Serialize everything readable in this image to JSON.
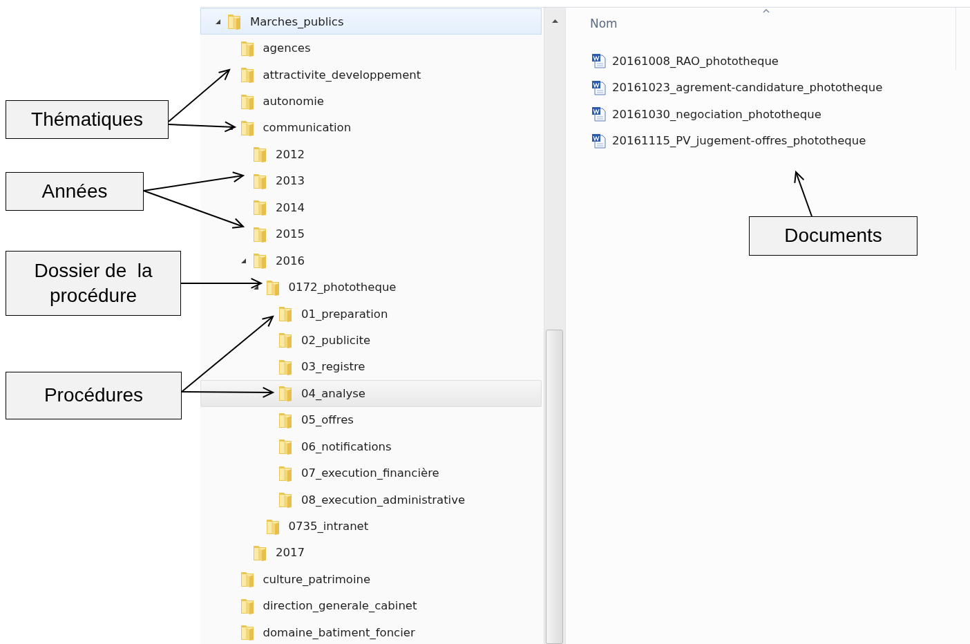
{
  "tree": [
    {
      "name": "Marches_publics",
      "selected": true,
      "hovered": false,
      "expanded": true,
      "children": [
        {
          "name": "agences",
          "selected": false,
          "hovered": false
        },
        {
          "name": "attractivite_developpement",
          "selected": false,
          "hovered": false
        },
        {
          "name": "autonomie",
          "selected": false,
          "hovered": false
        },
        {
          "name": "communication",
          "selected": false,
          "hovered": false,
          "expanded": true,
          "children": [
            {
              "name": "2012",
              "selected": false,
              "hovered": false
            },
            {
              "name": "2013",
              "selected": false,
              "hovered": false
            },
            {
              "name": "2014",
              "selected": false,
              "hovered": false
            },
            {
              "name": "2015",
              "selected": false,
              "hovered": false
            },
            {
              "name": "2016",
              "selected": false,
              "hovered": false,
              "expanded": true,
              "children": [
                {
                  "name": "0172_phototheque",
                  "selected": false,
                  "hovered": false,
                  "expanded": true,
                  "children": [
                    {
                      "name": "01_preparation",
                      "selected": false,
                      "hovered": false
                    },
                    {
                      "name": "02_publicite",
                      "selected": false,
                      "hovered": false
                    },
                    {
                      "name": "03_registre",
                      "selected": false,
                      "hovered": false
                    },
                    {
                      "name": "04_analyse",
                      "selected": false,
                      "hovered": true
                    },
                    {
                      "name": "05_offres",
                      "selected": false,
                      "hovered": false
                    },
                    {
                      "name": "06_notifications",
                      "selected": false,
                      "hovered": false
                    },
                    {
                      "name": "07_execution_financière",
                      "selected": false,
                      "hovered": false
                    },
                    {
                      "name": "08_execution_administrative",
                      "selected": false,
                      "hovered": false
                    }
                  ]
                },
                {
                  "name": "0735_intranet",
                  "selected": false,
                  "hovered": false
                }
              ]
            },
            {
              "name": "2017",
              "selected": false,
              "hovered": false
            }
          ]
        },
        {
          "name": "culture_patrimoine",
          "selected": false,
          "hovered": false
        },
        {
          "name": "direction_generale_cabinet",
          "selected": false,
          "hovered": false
        },
        {
          "name": "domaine_batiment_foncier",
          "selected": false,
          "hovered": false
        }
      ]
    }
  ],
  "files": {
    "column": "Nom",
    "items": [
      {
        "name": "20161008_RAO_phototheque"
      },
      {
        "name": "20161023_agrement-candidature_phototheque"
      },
      {
        "name": "20161030_negociation_phototheque"
      },
      {
        "name": "20161115_PV_jugement-offres_phototheque"
      }
    ]
  },
  "callouts": [
    {
      "text": "Thématiques"
    },
    {
      "text": "Années"
    },
    {
      "text": "Dossier de  la procédure"
    },
    {
      "text": "Procédures"
    },
    {
      "text": "Documents"
    }
  ]
}
